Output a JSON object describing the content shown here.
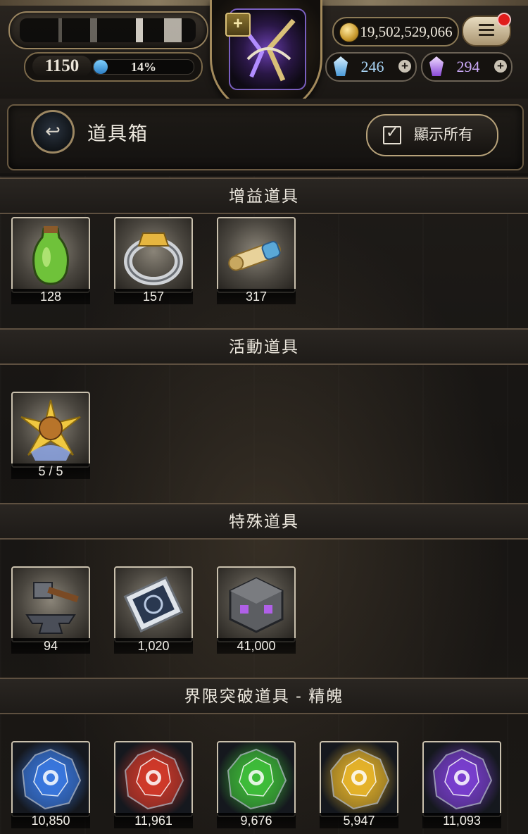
{
  "hud": {
    "level": "1150",
    "exp_percent_label": "14%",
    "exp_fill": 0.14,
    "gold": "19,502,529,066",
    "gem_blue": "246",
    "gem_purple": "294",
    "emblem_plus": "+"
  },
  "header": {
    "title": "道具箱",
    "show_all_label": "顯示所有",
    "back_icon": "↩"
  },
  "sections": [
    {
      "label": "增益道具",
      "items": [
        {
          "icon": "green-potion-icon",
          "count": "128"
        },
        {
          "icon": "silver-ring-icon",
          "count": "157"
        },
        {
          "icon": "scroll-icon",
          "count": "317"
        }
      ]
    },
    {
      "label": "活動道具",
      "items": [
        {
          "icon": "golden-star-orb-icon",
          "count": "5 / 5"
        }
      ]
    },
    {
      "label": "特殊道具",
      "items": [
        {
          "icon": "hammer-anvil-icon",
          "count": "94"
        },
        {
          "icon": "seal-ticket-icon",
          "count": "1,020"
        },
        {
          "icon": "stone-cube-icon",
          "count": "41,000"
        }
      ]
    },
    {
      "label": "界限突破道具 - 精魄",
      "items": [
        {
          "icon": "blue-essence-icon",
          "count": "10,850"
        },
        {
          "icon": "red-essence-icon",
          "count": "11,961"
        },
        {
          "icon": "green-essence-icon",
          "count": "9,676"
        },
        {
          "icon": "yellow-essence-icon",
          "count": "5,947"
        },
        {
          "icon": "purple-essence-icon",
          "count": "11,093"
        }
      ]
    }
  ],
  "colors": {
    "essence_blue": "#3a78e0",
    "essence_red": "#d23a2a",
    "essence_green": "#3fbf3a",
    "essence_yellow": "#e8b52a",
    "essence_purple": "#7a3fd0"
  }
}
